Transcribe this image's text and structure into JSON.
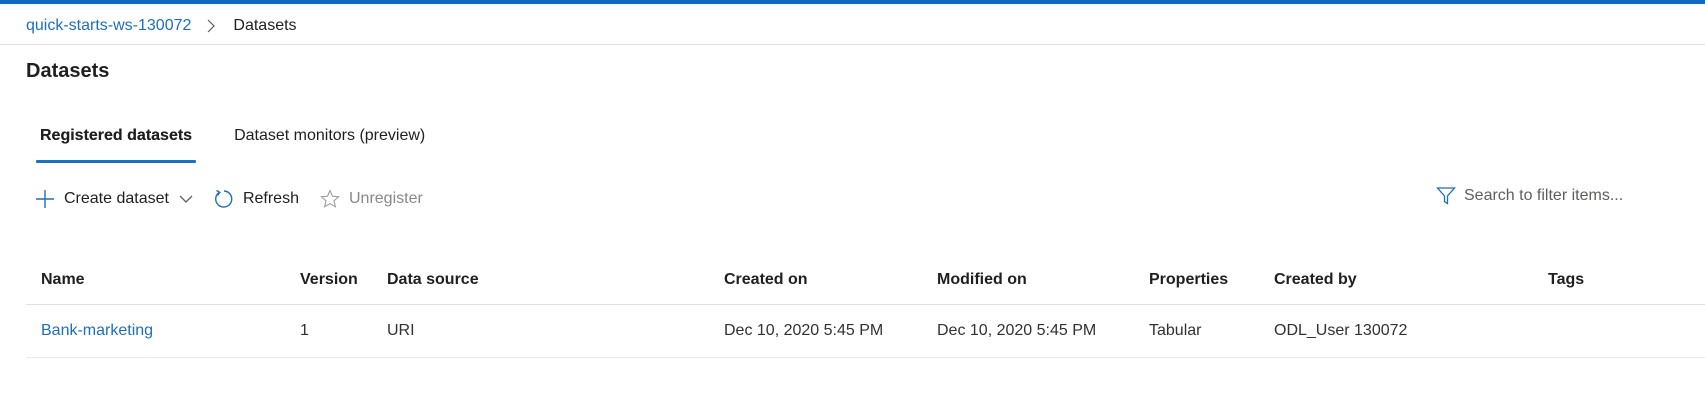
{
  "colors": {
    "accent": "#1d6fbf",
    "topbar": "#0f6cbd",
    "disabled": "#8a8886"
  },
  "breadcrumb": {
    "workspace": "quick-starts-ws-130072",
    "separator_icon": "chevron-right-icon",
    "current": "Datasets"
  },
  "page": {
    "title": "Datasets"
  },
  "tabs": [
    {
      "label": "Registered datasets",
      "active": true
    },
    {
      "label": "Dataset monitors (preview)",
      "active": false
    }
  ],
  "toolbar": {
    "create_label": "Create dataset",
    "create_icon": "plus-icon",
    "refresh_label": "Refresh",
    "refresh_icon": "refresh-icon",
    "unregister_label": "Unregister",
    "unregister_icon": "star-icon"
  },
  "search": {
    "placeholder": "Search to filter items...",
    "icon": "filter-icon"
  },
  "table": {
    "columns": [
      "Name",
      "Version",
      "Data source",
      "Created on",
      "Modified on",
      "Properties",
      "Created by",
      "Tags"
    ],
    "rows": [
      {
        "name": "Bank-marketing",
        "version": "1",
        "data_source": "URI",
        "created_on": "Dec 10, 2020 5:45 PM",
        "modified_on": "Dec 10, 2020 5:45 PM",
        "properties": "Tabular",
        "created_by": "ODL_User 130072",
        "tags": ""
      }
    ]
  }
}
